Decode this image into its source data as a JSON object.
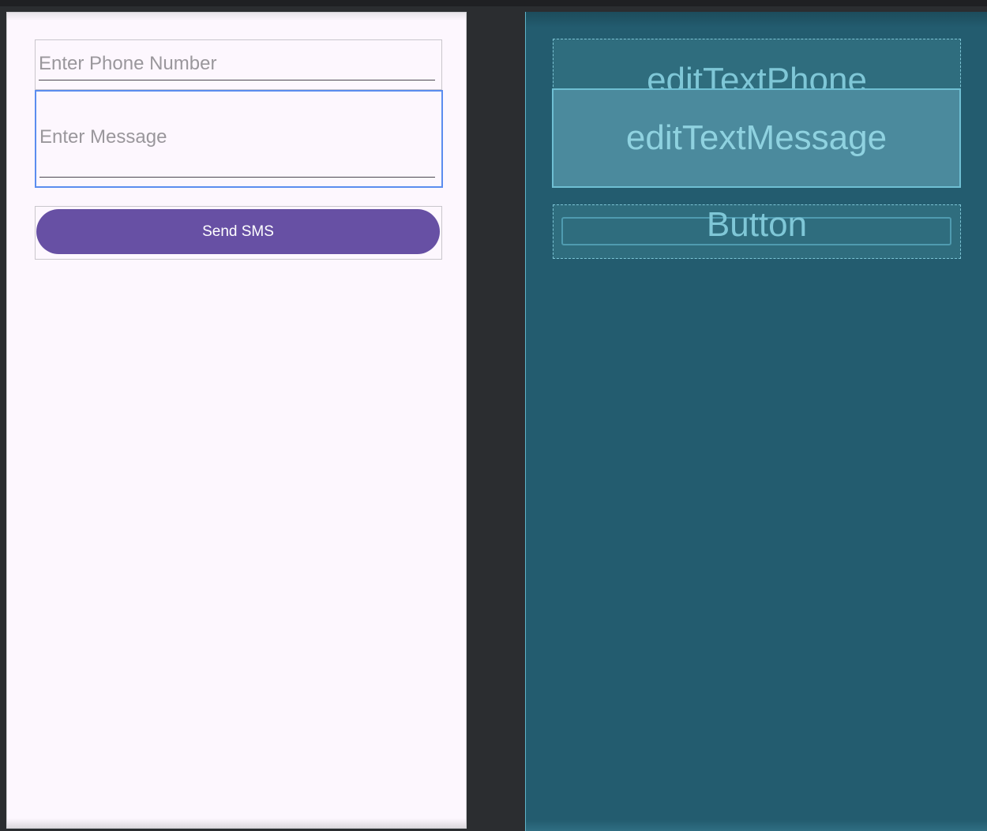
{
  "design_preview": {
    "phone_field": {
      "placeholder": "Enter Phone Number"
    },
    "message_field": {
      "placeholder": "Enter Message"
    },
    "send_button": {
      "label": "Send SMS"
    }
  },
  "blueprint": {
    "phone_label": "editTextPhone",
    "message_label": "editTextMessage",
    "button_label": "Button"
  },
  "colors": {
    "design_background": "#fdf7fe",
    "button_primary": "#6750a4",
    "selection_highlight": "#5b8def",
    "blueprint_background": "#235c6f"
  }
}
